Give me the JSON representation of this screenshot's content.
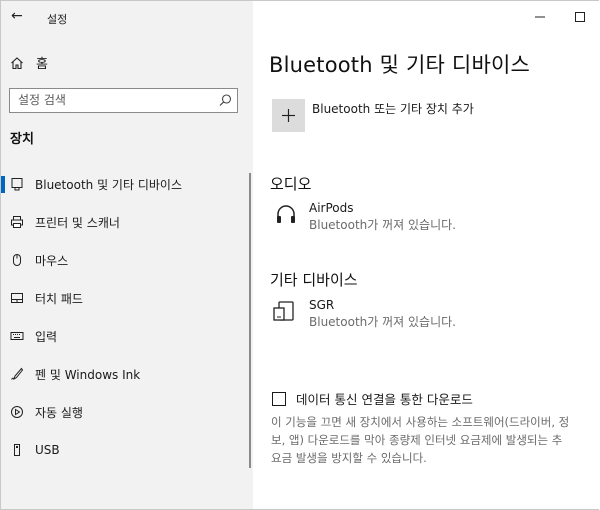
{
  "window": {
    "title": "설정"
  },
  "sidebar": {
    "home_label": "홈",
    "search_placeholder": "설정 검색",
    "section_label": "장치",
    "items": [
      {
        "label": "Bluetooth 및 기타 디바이스",
        "icon": "bluetooth-devices-icon",
        "active": true
      },
      {
        "label": "프린터 및 스캐너",
        "icon": "printer-icon"
      },
      {
        "label": "마우스",
        "icon": "mouse-icon"
      },
      {
        "label": "터치 패드",
        "icon": "touchpad-icon"
      },
      {
        "label": "입력",
        "icon": "keyboard-icon"
      },
      {
        "label": "펜 및 Windows Ink",
        "icon": "pen-icon"
      },
      {
        "label": "자동 실행",
        "icon": "autoplay-icon"
      },
      {
        "label": "USB",
        "icon": "usb-icon"
      }
    ]
  },
  "main": {
    "title": "Bluetooth 및 기타 디바이스",
    "add_label": "Bluetooth 또는 기타 장치 추가",
    "audio": {
      "heading": "오디오",
      "device": {
        "name": "AirPods",
        "status": "Bluetooth가 꺼져 있습니다.",
        "icon": "headphones-icon"
      }
    },
    "other": {
      "heading": "기타 디바이스",
      "device": {
        "name": "SGR",
        "status": "Bluetooth가 꺼져 있습니다.",
        "icon": "device-icon"
      }
    },
    "metered": {
      "checkbox_label": "데이터 통신 연결을 통한 다운로드",
      "checked": false,
      "description_lines": [
        "이 기능을 끄면 새 장치에서 사용하는 소프트웨어(드라이버, 정",
        "보, 앱) 다운로드를 막아 종량제 인터넷 요금제에 발생되는 추",
        "요금 발생을 방지할 수 있습니다."
      ]
    }
  }
}
